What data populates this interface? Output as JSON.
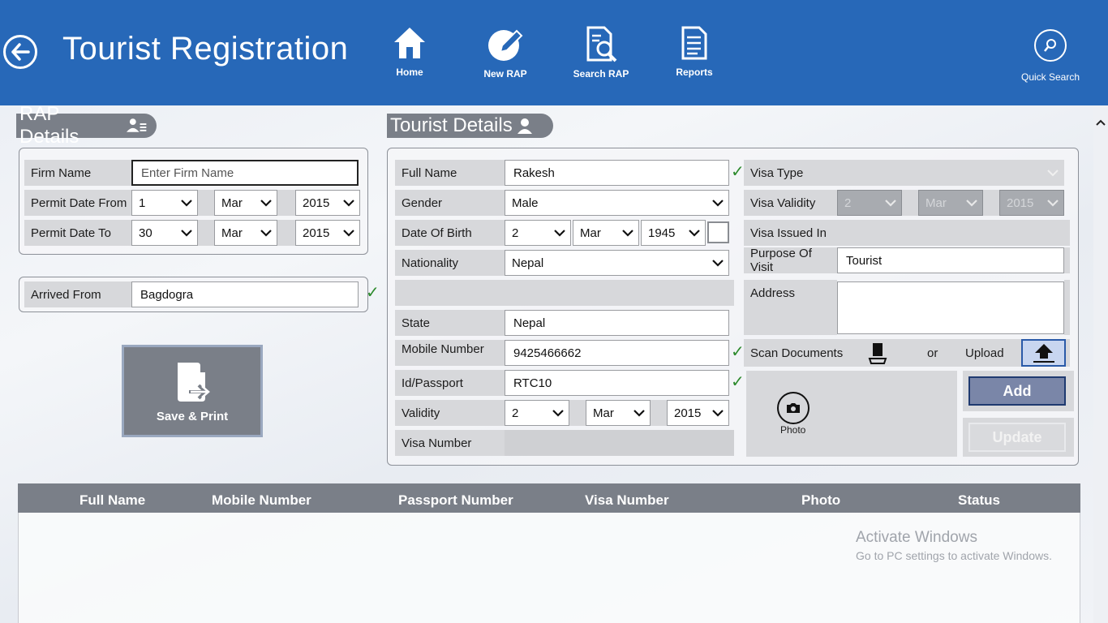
{
  "header": {
    "title": "Tourist Registration",
    "nav": [
      {
        "label": "Home",
        "icon": "home-icon"
      },
      {
        "label": "New RAP",
        "icon": "new-rap-icon"
      },
      {
        "label": "Search RAP",
        "icon": "search-rap-icon"
      },
      {
        "label": "Reports",
        "icon": "reports-icon"
      }
    ],
    "quick_search": "Quick Search"
  },
  "rap": {
    "title": "RAP Details",
    "firm_name_label": "Firm Name",
    "firm_name_placeholder": "Enter Firm Name",
    "permit_from_label": "Permit Date From",
    "permit_from": {
      "day": "1",
      "month": "Mar",
      "year": "2015"
    },
    "permit_to_label": "Permit Date To",
    "permit_to": {
      "day": "30",
      "month": "Mar",
      "year": "2015"
    },
    "arrived_from_label": "Arrived From",
    "arrived_from": "Bagdogra",
    "save_print": "Save & Print"
  },
  "tourist": {
    "title": "Tourist Details",
    "full_name_label": "Full Name",
    "full_name": "Rakesh",
    "gender_label": "Gender",
    "gender": "Male",
    "dob_label": "Date Of Birth",
    "dob": {
      "day": "2",
      "month": "Mar",
      "year": "1945"
    },
    "nationality_label": "Nationality",
    "nationality": "Nepal",
    "state_label": "State",
    "state": "Nepal",
    "mobile_label": "Mobile Number",
    "mobile": "9425466662",
    "id_label": "Id/Passport",
    "id": "RTC10",
    "validity_label": "Validity",
    "validity": {
      "day": "2",
      "month": "Mar",
      "year": "2015"
    },
    "visa_number_label": "Visa Number",
    "visa_type_label": "Visa Type",
    "visa_validity_label": "Visa Validity",
    "visa_validity": {
      "day": "2",
      "month": "Mar",
      "year": "2015"
    },
    "visa_issued_label": "Visa Issued In",
    "purpose_label": "Purpose Of Visit",
    "purpose": "Tourist",
    "address_label": "Address",
    "scan_label": "Scan Documents",
    "or": "or",
    "upload": "Upload",
    "photo": "Photo",
    "add": "Add",
    "update": "Update"
  },
  "table": {
    "columns": [
      "Full Name",
      "Mobile Number",
      "Passport Number",
      "Visa Number",
      "Photo",
      "Status"
    ]
  },
  "watermark": {
    "line1": "Activate Windows",
    "line2": "Go to PC settings to activate Windows."
  },
  "colors": {
    "header_bg": "#2768b8",
    "panel_grey": "#7a7f88",
    "check_green": "#2c8a2c"
  }
}
